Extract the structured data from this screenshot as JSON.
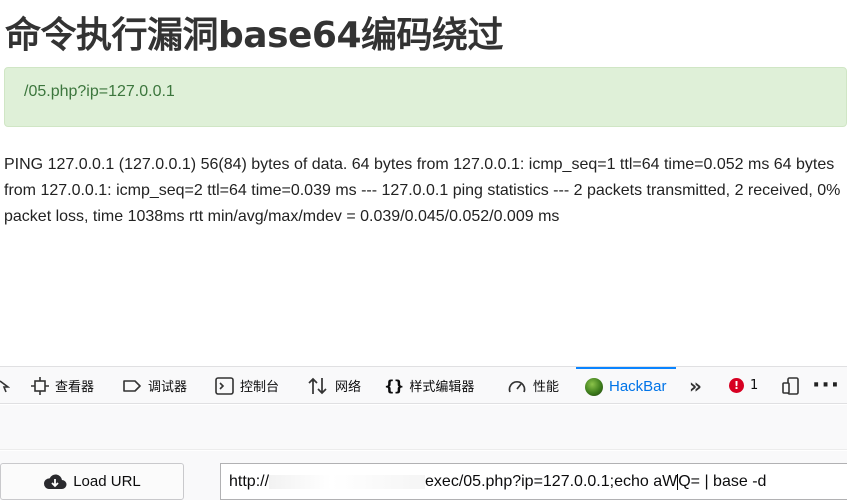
{
  "page": {
    "title": "命令执行漏洞base64编码绕过",
    "url_path": "/05.php?ip=127.0.0.1",
    "ping_output": "PING 127.0.0.1 (127.0.0.1) 56(84) bytes of data. 64 bytes from 127.0.0.1: icmp_seq=1 ttl=64 time=0.052 ms 64 bytes from 127.0.0.1: icmp_seq=2 ttl=64 time=0.039 ms --- 127.0.0.1 ping statistics --- 2 packets transmitted, 2 received, 0% packet loss, time 1038ms rtt min/avg/max/mdev = 0.039/0.045/0.052/0.009 ms"
  },
  "devtools": {
    "tabs": [
      {
        "label": "查看器",
        "icon": "inspector-icon"
      },
      {
        "label": "调试器",
        "icon": "debugger-icon"
      },
      {
        "label": "控制台",
        "icon": "console-icon"
      },
      {
        "label": "网络",
        "icon": "network-icon"
      },
      {
        "label": "样式编辑器",
        "icon": "style-editor-icon"
      },
      {
        "label": "性能",
        "icon": "performance-icon"
      },
      {
        "label": "HackBar",
        "icon": "hackbar-icon",
        "active": true
      }
    ],
    "error_count": "1",
    "colors": {
      "active_tab": "#0074e8",
      "error_badge": "#d70022",
      "alert_bg": "#dff0d8",
      "alert_text": "#3c763d"
    }
  },
  "hackbar": {
    "load_url_label": "Load URL",
    "url_prefix": "http://",
    "url_value_left": "exec/05.php?ip=127.0.0.1;echo aW",
    "url_value_right": "Q= | base -d"
  }
}
